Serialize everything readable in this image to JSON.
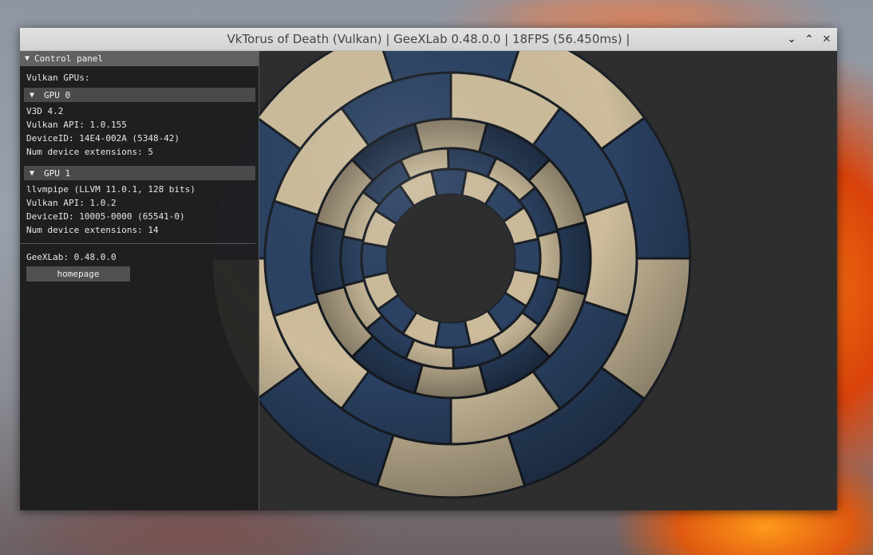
{
  "window": {
    "title": "VkTorus of Death (Vulkan) | GeeXLab 0.48.0.0 | 18FPS (56.450ms) |",
    "controls": {
      "minimize": "⌄",
      "maximize": "⌃",
      "close": "✕"
    }
  },
  "panel": {
    "header": "Control panel",
    "vulkan_gpus_label": "Vulkan GPUs:",
    "gpus": [
      {
        "header": "GPU 0",
        "lines": [
          "V3D 4.2",
          "Vulkan API: 1.0.155",
          "DeviceID: 14E4-002A (5348-42)",
          "Num device extensions: 5"
        ]
      },
      {
        "header": "GPU 1",
        "lines": [
          "llvmpipe (LLVM 11.0.1, 128 bits)",
          "Vulkan API: 1.0.2",
          "DeviceID: 10005-0000 (65541-0)",
          "Num device extensions: 14"
        ]
      }
    ],
    "version_label": "GeeXLab: 0.48.0.0",
    "homepage_button": "homepage",
    "collapse_glyph": "▼"
  },
  "colors": {
    "tile_light": "#cdbd9c",
    "tile_dark": "#2b4263",
    "viewport_bg": "#2e2e2e",
    "panel_header_bg": "#616161"
  }
}
